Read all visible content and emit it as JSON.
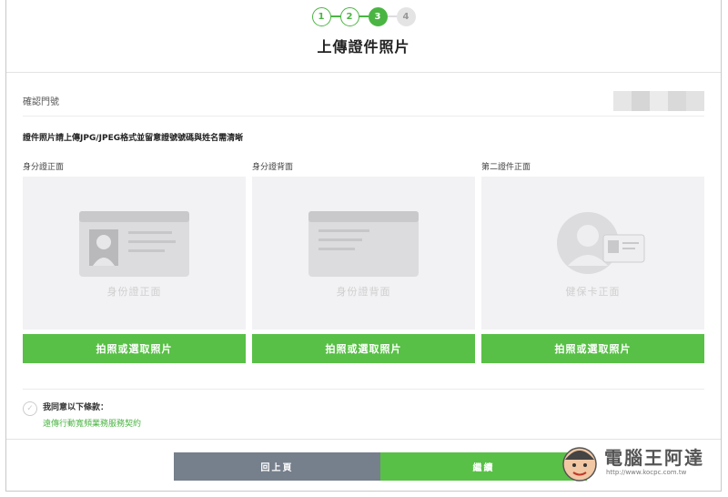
{
  "stepper": {
    "steps": [
      "1",
      "2",
      "3",
      "4"
    ]
  },
  "page_title": "上傳證件照片",
  "confirm": {
    "label": "確認門號"
  },
  "notice": "證件照片請上傳JPG/JPEG格式並留意證號號碼與姓名需清晰",
  "cards": [
    {
      "label": "身分證正面",
      "caption": "身份證正面",
      "button": "拍照或選取照片",
      "icon": "id-card-front-icon"
    },
    {
      "label": "身分證背面",
      "caption": "身份證背面",
      "button": "拍照或選取照片",
      "icon": "id-card-back-icon"
    },
    {
      "label": "第二證件正面",
      "caption": "健保卡正面",
      "button": "拍照或選取照片",
      "icon": "health-card-icon"
    }
  ],
  "agreement": {
    "title": "我同意以下條款：",
    "link": "遠傳行動寬頻業務服務契約"
  },
  "buttons": {
    "back": "回上頁",
    "next": "繼續"
  },
  "watermark": {
    "text": "電腦王阿達",
    "url": "http://www.kocpc.com.tw"
  },
  "colors": {
    "accent": "#58c046",
    "back_button": "#767f8c",
    "placeholder_bg": "#f2f2f4"
  }
}
